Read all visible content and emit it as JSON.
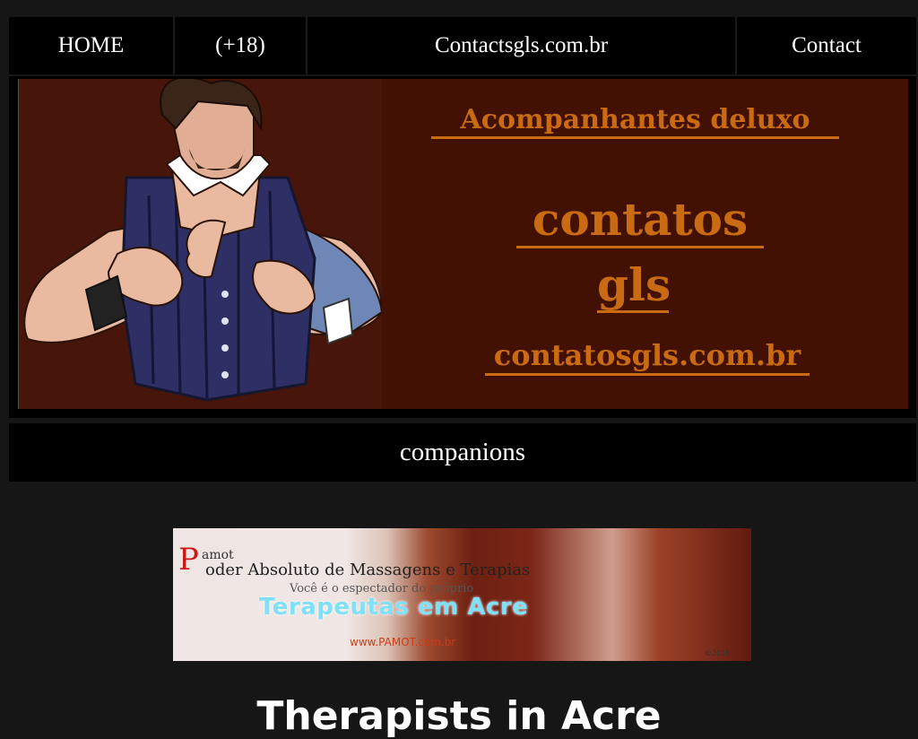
{
  "nav": {
    "items": [
      {
        "label": "HOME"
      },
      {
        "label": "(+18)"
      },
      {
        "label": "Contactsgls.com.br"
      },
      {
        "label": "Contact"
      }
    ]
  },
  "banner": {
    "line1": "Acompanhantes deluxo",
    "line2": "contatos",
    "line3": "gls",
    "line4": "contatosgls.com.br"
  },
  "section": {
    "title": "companions"
  },
  "ad": {
    "initial": "P",
    "pamot": "amot",
    "line1": "oder Absoluto de Massagens e Terapias",
    "line2": "Você é o espectador do próprio",
    "line3": "Terapeutas em Acre",
    "url": "www.PAMOT.com.br",
    "year": "©2016"
  },
  "page": {
    "heading": "Therapists in Acre"
  },
  "colors": {
    "background": "#161616",
    "nav_bg": "#000000",
    "banner_bg": "#431104",
    "banner_text": "#c96b12"
  }
}
